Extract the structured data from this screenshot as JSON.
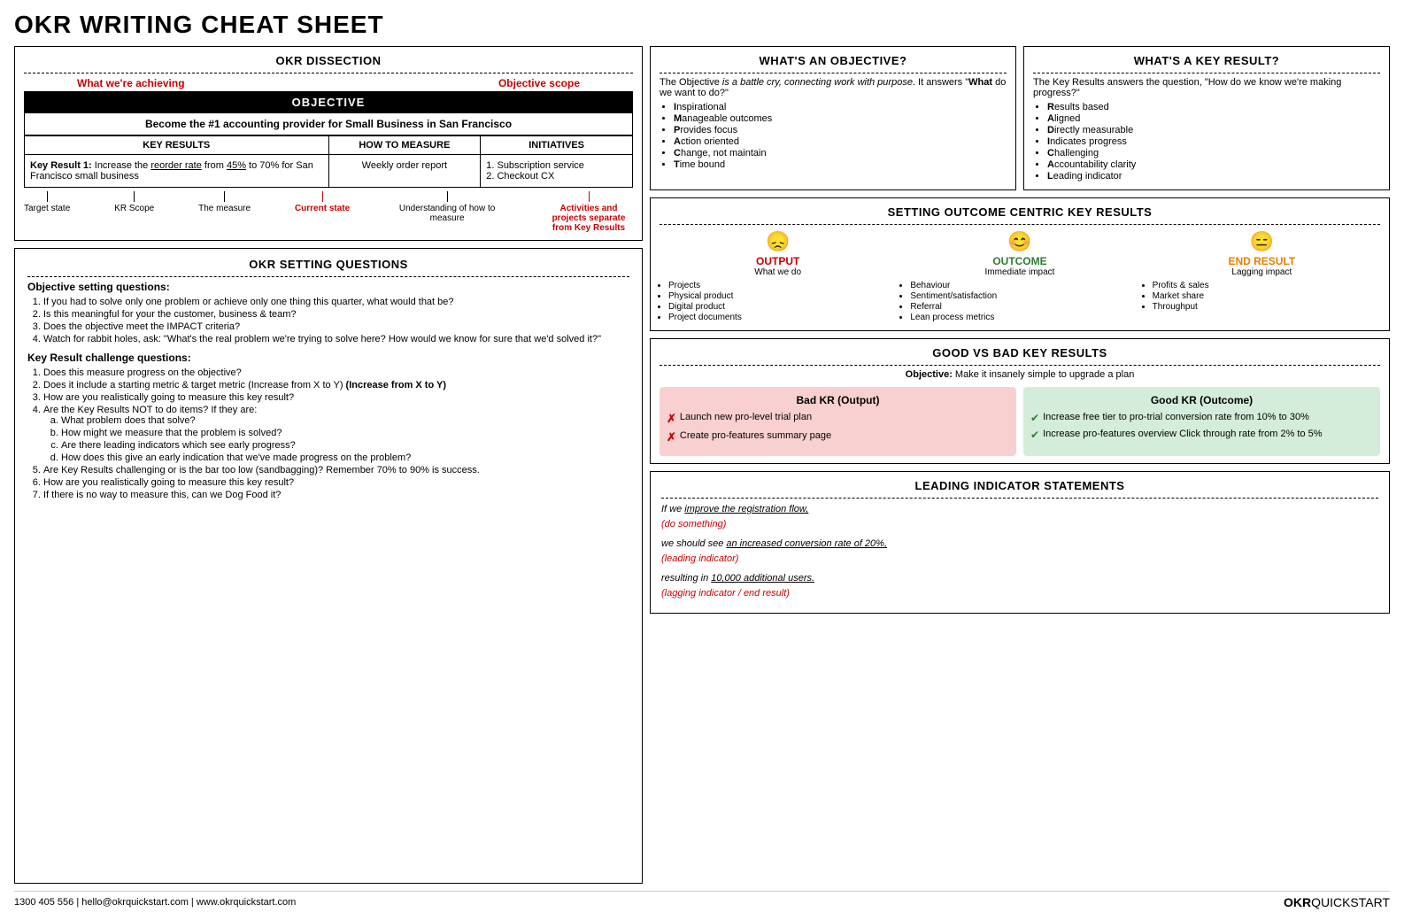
{
  "title": "OKR WRITING CHEAT SHEET",
  "dissection": {
    "section_title": "OKR DISSECTION",
    "label_achieving": "What we're achieving",
    "label_scope": "Objective scope",
    "objective_bar": "OBJECTIVE",
    "objective_text": "Become the #1 accounting provider for Small Business in San Francisco",
    "kr_header": "KEY RESULTS",
    "measure_header": "HOW TO MEASURE",
    "initiatives_header": "INITIATIVES",
    "kr1_text": "Key Result 1: Increase the reorder rate from 45% to 70% for San Francisco small business",
    "kr1_measure": "Weekly order report",
    "kr1_initiatives": "1. Subscription service\n2. Checkout CX",
    "ann_target": "Target state",
    "ann_kr_scope": "KR Scope",
    "ann_measure": "The measure",
    "ann_current": "Current state",
    "ann_how": "Understanding of how to measure",
    "ann_activities": "Activities and projects separate from Key Results"
  },
  "questions": {
    "section_title": "OKR SETTING QUESTIONS",
    "obj_subtitle": "Objective setting questions:",
    "obj_questions": [
      "If you had to solve only one problem or achieve only one thing this quarter, what would that be?",
      "Is this meaningful for your the customer, business & team?",
      "Does the objective meet the IMPACT criteria?",
      "Watch for rabbit holes, ask:  \"What's the real problem we're trying to solve here? How would we know for sure that we'd solved it?\""
    ],
    "kr_subtitle": "Key Result challenge questions:",
    "kr_questions": [
      "Does this measure progress on the objective?",
      "Does it include a starting metric & target metric (Increase from X to Y)",
      "How are you realistically going to measure this key result?",
      "Are the Key Results NOT to do items? If they are:",
      "Are Key Results challenging or is the bar too low (sandbagging)? Remember 70% to 90% is success.",
      "How are you realistically going to measure this key result?",
      "If there is no way to measure this, can we Dog Food it?"
    ],
    "kr_q4_sub": [
      "What problem does that solve?",
      "How might we measure that the problem is solved?",
      "Are there leading indicators which see early progress?",
      "How does this give an early indication that we've made progress on the problem?"
    ]
  },
  "whats_objective": {
    "title": "WHAT'S AN OBJECTIVE?",
    "intro": "The Objective is a battle cry, connecting work with purpose. It answers \"What do we want to do?\"",
    "bullets": [
      "Inspirational",
      "Manageable outcomes",
      "Provides focus",
      "Action oriented",
      "Change, not maintain",
      "Time bound"
    ],
    "bullet_bold_chars": [
      "I",
      "M",
      "P",
      "A",
      "C",
      "T"
    ]
  },
  "whats_kr": {
    "title": "WHAT'S A KEY RESULT?",
    "intro": "The Key Results answers the question, \"How do we know we're making progress?\"",
    "bullets": [
      "Results based",
      "Aligned",
      "Directly measurable",
      "Indicates progress",
      "Challenging",
      "Accountability clarity",
      "Leading indicator"
    ],
    "bullet_bold_chars": [
      "R",
      "A",
      "D",
      "I",
      "C",
      "A",
      "L"
    ]
  },
  "outcome_centric": {
    "title": "SETTING OUTCOME CENTRIC KEY RESULTS",
    "output_label": "OUTPUT",
    "output_sub": "What we do",
    "outcome_label": "OUTCOME",
    "outcome_sub": "Immediate impact",
    "end_label": "END RESULT",
    "end_sub": "Lagging impact",
    "output_bullets": [
      "Projects",
      "Physical product",
      "Digital product",
      "Project documents"
    ],
    "outcome_bullets": [
      "Behaviour",
      "Sentiment/satisfaction",
      "Referral",
      "Lean process metrics"
    ],
    "end_bullets": [
      "Profits & sales",
      "Market share",
      "Throughput"
    ]
  },
  "good_bad": {
    "title": "GOOD VS BAD KEY RESULTS",
    "objective_line": "Objective: Make it insanely simple to upgrade a plan",
    "bad_title": "Bad KR (Output)",
    "good_title": "Good KR (Outcome)",
    "bad_items": [
      "Launch new pro-level trial plan",
      "Create pro-features summary page"
    ],
    "good_items": [
      "Increase free tier to pro-trial conversion rate from 10% to 30%",
      "Increase pro-features overview Click through rate from 2% to 5%"
    ]
  },
  "leading_indicator": {
    "title": "LEADING INDICATOR STATEMENTS",
    "line1_normal": "If we ",
    "line1_underline": "improve the registration flow,",
    "line1_red": "(do something)",
    "line2_normal": "we should see ",
    "line2_underline": "an increased conversion rate of 20%,",
    "line2_red": "(leading indicator)",
    "line3_normal": "resulting in ",
    "line3_underline": "10,000 additional users.",
    "line3_red": "(lagging indicator / end result)"
  },
  "footer": {
    "contact": "1300 405 556 | hello@okrquickstart.com | www.okrquickstart.com",
    "logo_okr": "OKR",
    "logo_quick": "QUICKSTART"
  }
}
